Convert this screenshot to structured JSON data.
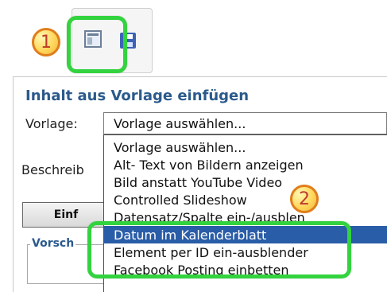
{
  "toolbar": {
    "buttons": [
      {
        "icon": "template-icon"
      },
      {
        "icon": "save-icon"
      }
    ],
    "callouts": [
      {
        "number": "1"
      }
    ]
  },
  "panel": {
    "title": "Inhalt aus Vorlage einfügen",
    "vorlage_label": "Vorlage:",
    "vorlage_selected": "Vorlage auswählen...",
    "beschreibung_label": "Beschreib",
    "insert_button_label": "Einf",
    "preview_label": "Vorsch"
  },
  "dropdown": {
    "options": [
      "Vorlage auswählen...",
      "Alt- Text von Bildern anzeigen",
      "Bild anstatt YouTube Video",
      "Controlled Slideshow",
      "Datensatz/Spalte ein-/ausblen",
      "Datum im Kalenderblatt",
      "Element per ID ein-ausblender",
      "Facebook Posting einbetten"
    ],
    "selected_index": 5,
    "callout_number": "2"
  }
}
